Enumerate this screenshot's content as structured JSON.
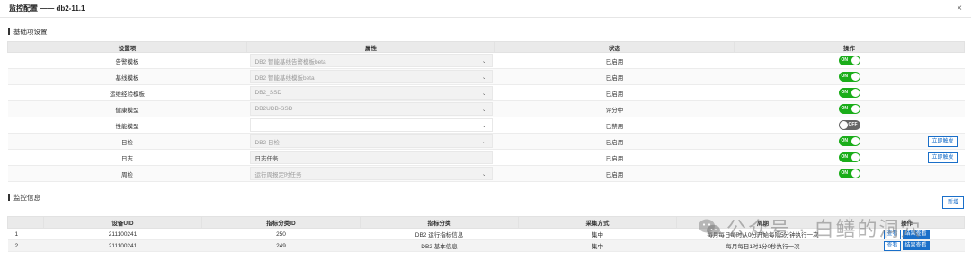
{
  "dialog": {
    "title": "监控配置 —— db2-11.1",
    "close_label": "×"
  },
  "basic": {
    "section_title": "基础项设置",
    "headers": [
      "设置项",
      "属性",
      "状态",
      "操作"
    ],
    "rows": [
      {
        "item": "告警模板",
        "attr": "DB2 智能基线告警模板beta",
        "status": "已启用",
        "toggle": "ON",
        "dropdown": true,
        "action": ""
      },
      {
        "item": "基线模板",
        "attr": "DB2 智能基线模板beta",
        "status": "已启用",
        "toggle": "ON",
        "dropdown": true,
        "action": ""
      },
      {
        "item": "运维经验模板",
        "attr": "DB2_SSD",
        "status": "已启用",
        "toggle": "ON",
        "dropdown": true,
        "action": ""
      },
      {
        "item": "健康模型",
        "attr": "DB2UDB-SSD",
        "status": "评分中",
        "toggle": "ON",
        "dropdown": true,
        "action": ""
      },
      {
        "item": "性能模型",
        "attr": "",
        "status": "已禁用",
        "toggle": "OFF",
        "dropdown": true,
        "action": ""
      },
      {
        "item": "日检",
        "attr": "DB2 日检",
        "status": "已启用",
        "toggle": "ON",
        "dropdown": true,
        "action": "立即触发"
      },
      {
        "item": "日志",
        "attr": "日志任务",
        "status": "已启用",
        "toggle": "ON",
        "dropdown": false,
        "action": "立即触发"
      },
      {
        "item": "周检",
        "attr": "运行周报定时任务",
        "status": "已启用",
        "toggle": "ON",
        "dropdown": true,
        "action": ""
      }
    ]
  },
  "monitor": {
    "section_title": "监控信息",
    "add_label": "新增",
    "headers": [
      "",
      "设备UID",
      "指标分类ID",
      "指标分类",
      "采集方式",
      "周期",
      "操作"
    ],
    "rows": [
      {
        "idx": "1",
        "uid": "211100241",
        "cat_id": "250",
        "category": "DB2 运行指标信息",
        "method": "集中",
        "period": "每月每日每时从0分开始每隔5分钟执行一次",
        "view": "查看",
        "result": "结果查看"
      },
      {
        "idx": "2",
        "uid": "211100241",
        "cat_id": "249",
        "category": "DB2 基本信息",
        "method": "集中",
        "period": "每月每日1时1分0秒执行一次",
        "view": "查看",
        "result": "结果查看"
      }
    ]
  },
  "watermark": {
    "text": "公众号 · 白鳝的洞穴"
  },
  "colors": {
    "toggle_on": "#1aad19",
    "toggle_off": "#666666",
    "accent": "#1a6fc9"
  }
}
